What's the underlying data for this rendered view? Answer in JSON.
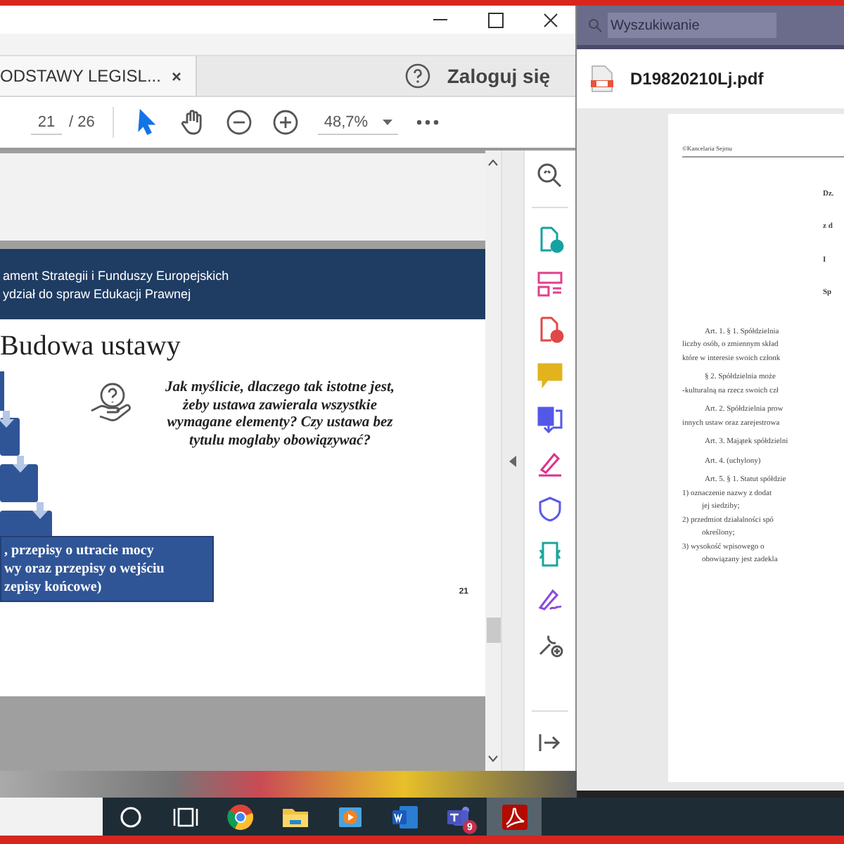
{
  "acrobat_window": {
    "tab": {
      "label": "ODSTAWY LEGISL...",
      "selected": true
    },
    "sign_in": "Zaloguj się",
    "page_number": "21",
    "page_count": "/ 26",
    "zoom": "48,7%",
    "toolbar_tools": [
      {
        "kind": "select",
        "selected": true
      },
      {
        "kind": "hand",
        "selected": false
      },
      {
        "kind": "zoom_out",
        "selected": false
      },
      {
        "kind": "zoom_in",
        "selected": false
      }
    ],
    "slide": {
      "header_lines": [
        "ament Strategii i Funduszy Europejskich",
        "ydział do spraw Edukacji Prawnej"
      ],
      "title": "Budowa ustawy",
      "question": "Jak myślicie, dlaczego tak istotne jest, żeby ustawa zawierala wszystkie wymagane elementy? Czy ustawa bez tytulu moglaby obowiązywać?",
      "box_lines": [
        ", przepisy o utracie mocy",
        "wy oraz przepisy o wejściu",
        "zepisy końcowe)"
      ],
      "page_label": "21"
    },
    "tools": [
      {
        "kind": "zoom"
      },
      {
        "kind": "export"
      },
      {
        "kind": "organize"
      },
      {
        "kind": "create"
      },
      {
        "kind": "comment"
      },
      {
        "kind": "combine"
      },
      {
        "kind": "fill"
      },
      {
        "kind": "protect"
      },
      {
        "kind": "compress"
      },
      {
        "kind": "sign"
      },
      {
        "kind": "more"
      },
      {
        "kind": "exit"
      }
    ]
  },
  "viewer_window": {
    "search_placeholder": "Wyszukiwanie",
    "file_name": "D19820210Lj.pdf",
    "document_lines": [
      {
        "kind": "header",
        "text": "©Kancelaria Sejmu"
      },
      {
        "kind": "center",
        "text": "Dz."
      },
      {
        "kind": "center",
        "text": "z d"
      },
      {
        "kind": "center",
        "text": "I"
      },
      {
        "kind": "center",
        "text": "Sp"
      },
      {
        "kind": "para",
        "text": "Art. 1. § 1. Spółdzielnia"
      },
      {
        "kind": "line",
        "text": "liczby osób, o zmiennym skład"
      },
      {
        "kind": "line",
        "text": "które w interesie swoich członk"
      },
      {
        "kind": "para",
        "text": "§ 2. Spółdzielnia może"
      },
      {
        "kind": "line",
        "text": "-kulturalną na rzecz swoich czł"
      },
      {
        "kind": "para",
        "text": "Art. 2. Spółdzielnia prow"
      },
      {
        "kind": "line",
        "text": "innych ustaw oraz zarejestrowa"
      },
      {
        "kind": "para",
        "text": "Art. 3. Majątek spółdzielni"
      },
      {
        "kind": "para",
        "text": "Art. 4. (uchylony)"
      },
      {
        "kind": "para",
        "text": "Art. 5. § 1. Statut spółdzie"
      },
      {
        "kind": "list",
        "text": "1)   oznaczenie nazwy z dodat"
      },
      {
        "kind": "cont",
        "text": "jej siedziby;"
      },
      {
        "kind": "list",
        "text": "2)   przedmiot działalności spó"
      },
      {
        "kind": "cont",
        "text": "określony;"
      },
      {
        "kind": "list",
        "text": "3)   wysokość wpisowego o"
      },
      {
        "kind": "cont",
        "text": "obowiązany jest zadekla"
      }
    ]
  },
  "taskbar": {
    "apps": [
      {
        "kind": "cortana",
        "selected": false
      },
      {
        "kind": "task_view",
        "selected": false
      },
      {
        "kind": "browser",
        "selected": false
      },
      {
        "kind": "folder",
        "selected": false
      },
      {
        "kind": "media",
        "selected": false
      },
      {
        "kind": "word",
        "selected": false
      },
      {
        "kind": "teams",
        "selected": false,
        "badge": "9"
      },
      {
        "kind": "acrobat",
        "selected": true
      }
    ]
  }
}
